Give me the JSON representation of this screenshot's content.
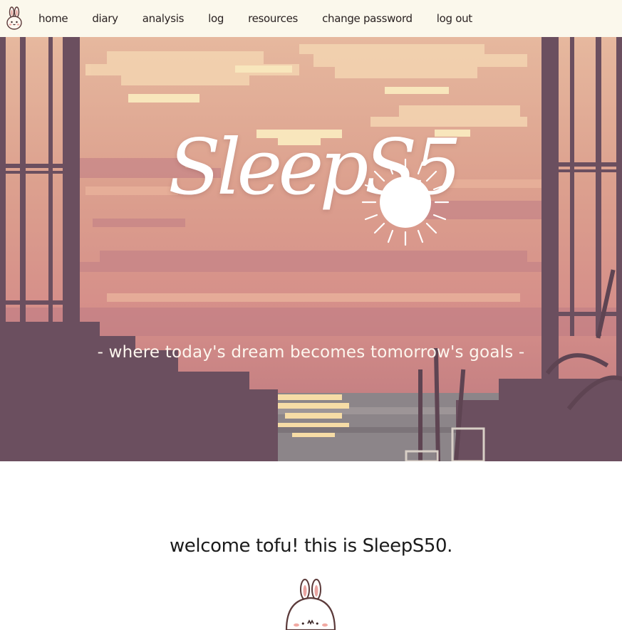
{
  "navbar": {
    "brand_icon": "bunny-icon",
    "links": [
      {
        "label": "home"
      },
      {
        "label": "diary"
      },
      {
        "label": "analysis"
      },
      {
        "label": "log"
      },
      {
        "label": "resources"
      },
      {
        "label": "change password"
      },
      {
        "label": "log out"
      }
    ]
  },
  "hero": {
    "title": "SleepS5",
    "title_icon": "sun-icon",
    "tagline": "- where today's dream becomes tomorrow's goals -",
    "colors": {
      "sky_top": "#f0c9a8",
      "sky_mid": "#d9938d",
      "silhouette": "#6b4f5e",
      "water": "#8a8488",
      "glow": "#f8e6b8"
    }
  },
  "welcome": {
    "text": "welcome tofu! this is SleepS50."
  },
  "mascot": {
    "icon": "bunny-mascot-icon"
  }
}
